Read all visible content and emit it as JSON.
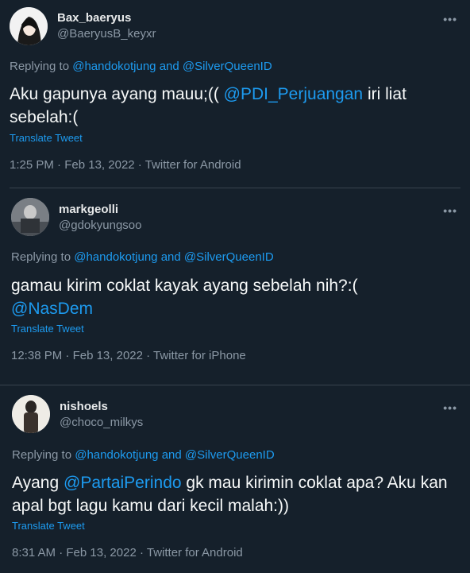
{
  "tweets": [
    {
      "name": "Bax_baeryus",
      "handle": "@BaeryusB_keyxr",
      "reply_prefix": "Replying to ",
      "reply_user1": "@handokotjung",
      "reply_and": " and ",
      "reply_user2": "@SilverQueenID",
      "text_part1": "Aku gapunya ayang mauu;(( ",
      "mention": "@PDI_Perjuangan",
      "text_part2": " iri liat sebelah:(",
      "translate": "Translate Tweet",
      "time": "1:25 PM",
      "date": "Feb 13, 2022",
      "source": "Twitter for Android",
      "more_icon": "more-icon"
    },
    {
      "name": "markgeolli",
      "handle": "@gdokyungsoo",
      "reply_prefix": "Replying to ",
      "reply_user1": "@handokotjung",
      "reply_and": " and ",
      "reply_user2": "@SilverQueenID",
      "text_part1": "gamau kirim coklat kayak ayang sebelah nih?:(",
      "mention": "@NasDem",
      "text_part2": "",
      "translate": "Translate Tweet",
      "time": "12:38 PM",
      "date": "Feb 13, 2022",
      "source": "Twitter for iPhone",
      "more_icon": "more-icon"
    },
    {
      "name": "nishoels",
      "handle": "@choco_milkys",
      "reply_prefix": "Replying to ",
      "reply_user1": "@handokotjung",
      "reply_and": " and ",
      "reply_user2": "@SilverQueenID",
      "text_part1": "Ayang ",
      "mention": "@PartaiPerindo",
      "text_part2": " gk mau kirimin coklat apa? Aku kan apal bgt lagu kamu dari kecil malah:))",
      "translate": "Translate Tweet",
      "time": "8:31 AM",
      "date": "Feb 13, 2022",
      "source": "Twitter for Android",
      "more_icon": "more-icon"
    }
  ],
  "separator": " · ",
  "more_glyph": "•••",
  "colors": {
    "background": "#15202b",
    "accent": "#1d9bf0",
    "muted": "#8b98a5",
    "divider": "#38444d"
  }
}
